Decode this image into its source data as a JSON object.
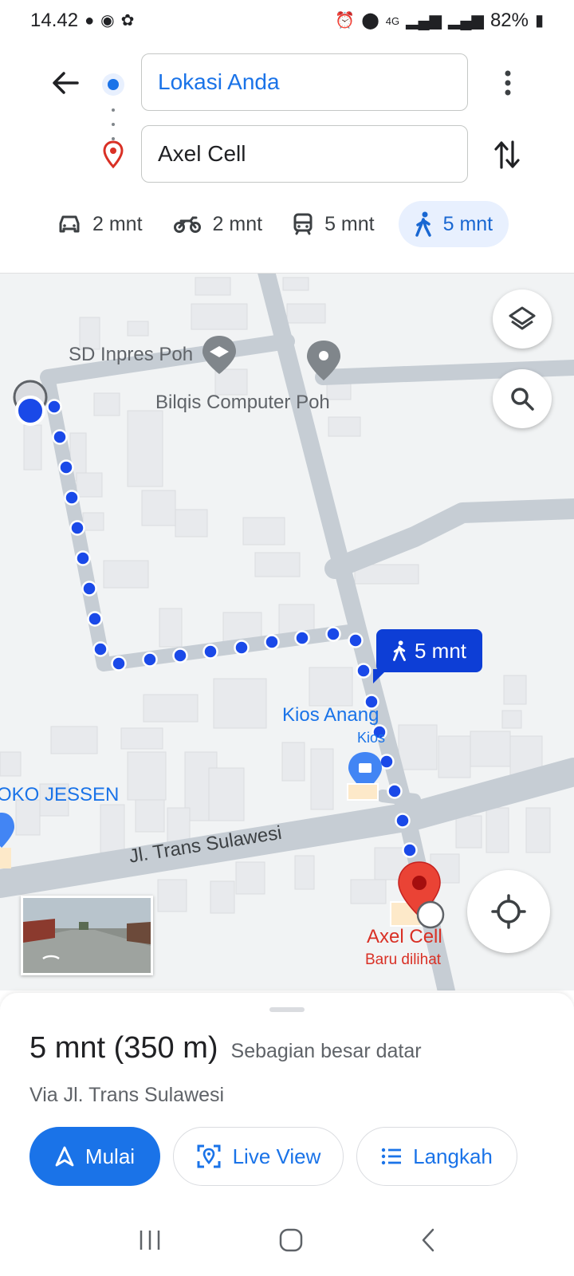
{
  "status_bar": {
    "time": "14.42",
    "battery": "82%",
    "network": "4G"
  },
  "route": {
    "origin": "Lokasi Anda",
    "destination": "Axel Cell"
  },
  "modes": [
    {
      "icon": "car-icon",
      "label": "2 mnt"
    },
    {
      "icon": "motorcycle-icon",
      "label": "2 mnt"
    },
    {
      "icon": "transit-icon",
      "label": "5 mnt"
    },
    {
      "icon": "walk-icon",
      "label": "5 mnt",
      "active": true
    }
  ],
  "map": {
    "labels": {
      "school": "SD Inpres Poh",
      "shop": "Bilqis Computer Poh",
      "kios_name": "Kios Anang",
      "kios_type": "Kios",
      "toko": "OKO JESSEN",
      "road": "Jl. Trans Sulawesi",
      "destination_name": "Axel Cell",
      "destination_sub": "Baru dilihat"
    },
    "walk_callout": "5 mnt"
  },
  "summary": {
    "duration": "5 mnt (350 m)",
    "terrain": "Sebagian besar datar",
    "via": "Via Jl. Trans Sulawesi"
  },
  "actions": {
    "start": "Mulai",
    "live_view": "Live View",
    "steps": "Langkah"
  },
  "colors": {
    "accent": "#1a73e8",
    "route_dot": "#1a49e8",
    "callout": "#0d3ed6",
    "pin": "#d93025"
  }
}
